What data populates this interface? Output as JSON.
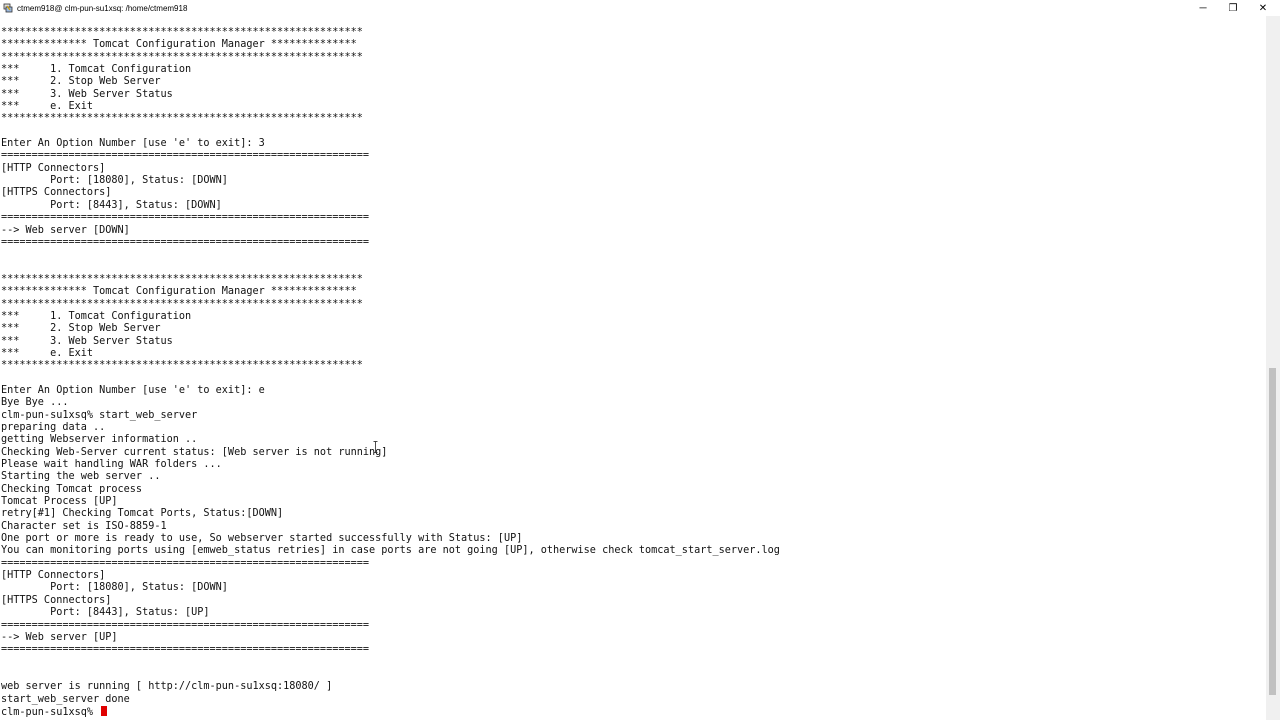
{
  "window": {
    "title": "ctmem918@ clm-pun-su1xsq: /home/ctmem918",
    "minimize_glyph": "─",
    "restore_glyph": "❐",
    "close_glyph": "✕"
  },
  "terminal": {
    "lines": [
      "***********************************************************",
      "************** Tomcat Configuration Manager **************",
      "***********************************************************",
      "***     1. Tomcat Configuration",
      "***     2. Stop Web Server",
      "***     3. Web Server Status",
      "***     e. Exit",
      "***********************************************************",
      "",
      "Enter An Option Number [use 'e' to exit]: 3",
      "============================================================",
      "[HTTP Connectors]",
      "        Port: [18080], Status: [DOWN]",
      "[HTTPS Connectors]",
      "        Port: [8443], Status: [DOWN]",
      "============================================================",
      "--> Web server [DOWN]",
      "============================================================",
      "",
      "",
      "***********************************************************",
      "************** Tomcat Configuration Manager **************",
      "***********************************************************",
      "***     1. Tomcat Configuration",
      "***     2. Stop Web Server",
      "***     3. Web Server Status",
      "***     e. Exit",
      "***********************************************************",
      "",
      "Enter An Option Number [use 'e' to exit]: e",
      "Bye Bye ...",
      "clm-pun-su1xsq% start_web_server",
      "preparing data ..",
      "getting Webserver information ..",
      "Checking Web-Server current status: [Web server is not running]",
      "Please wait handling WAR folders ...",
      "Starting the web server ..",
      "Checking Tomcat process",
      "Tomcat Process [UP]",
      "retry[#1] Checking Tomcat Ports, Status:[DOWN]",
      "Character set is ISO-8859-1",
      "One port or more is ready to use, So webserver started successfully with Status: [UP]",
      "You can monitoring ports using [emweb_status retries] in case ports are not going [UP], otherwise check tomcat_start_server.log",
      "============================================================",
      "[HTTP Connectors]",
      "        Port: [18080], Status: [DOWN]",
      "[HTTPS Connectors]",
      "        Port: [8443], Status: [UP]",
      "============================================================",
      "--> Web server [UP]",
      "============================================================",
      "",
      "",
      "web server is running [ http://clm-pun-su1xsq:18080/ ]",
      "start_web_server done"
    ],
    "prompt": "clm-pun-su1xsq% ",
    "cursor_color": "#e00000"
  }
}
